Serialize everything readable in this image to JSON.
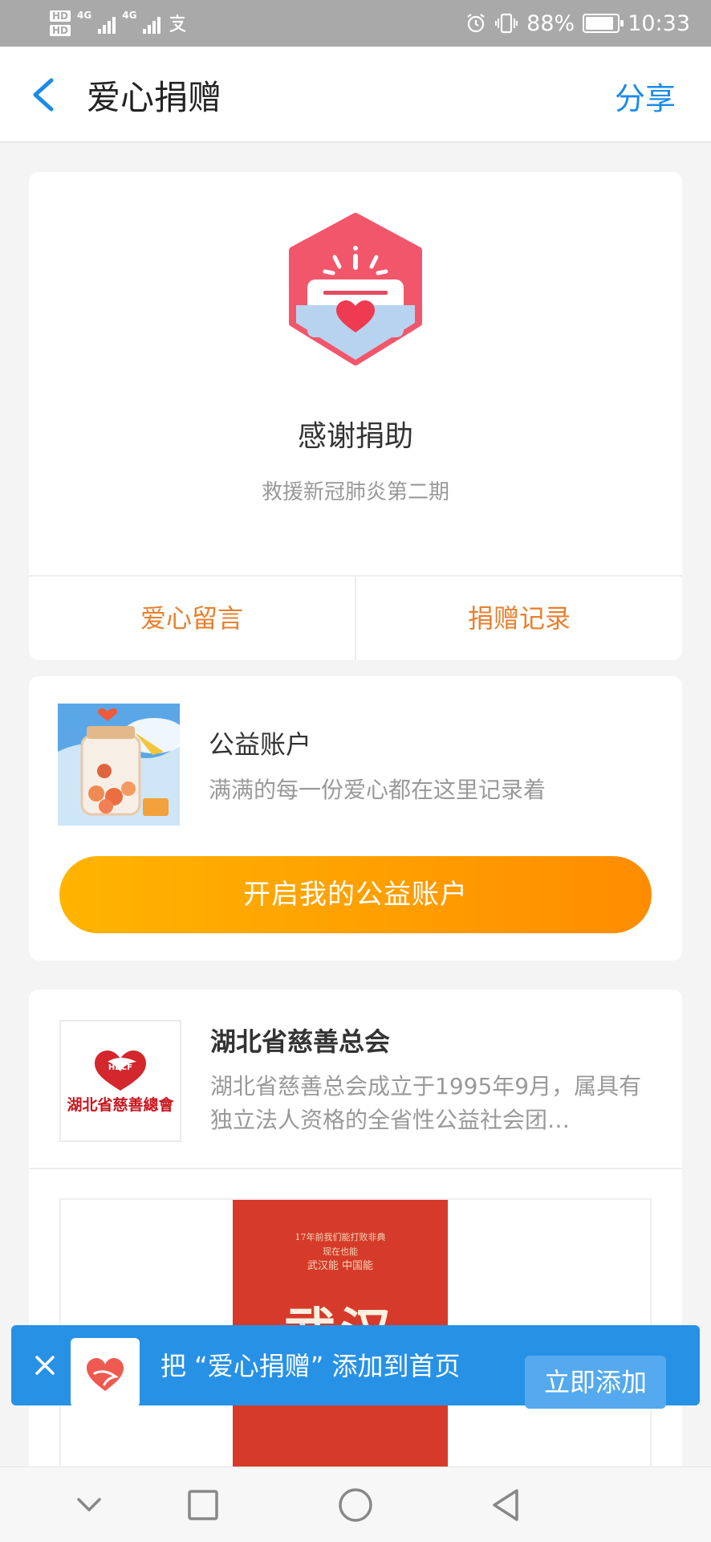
{
  "status_bar": {
    "hd1": "HD",
    "hd2": "HD",
    "net1": "4G",
    "net2": "4G",
    "battery_pct": "88%",
    "battery_level": 0.88,
    "time": "10:33"
  },
  "header": {
    "title": "爱心捐赠",
    "share_label": "分享"
  },
  "donation_card": {
    "thanks_text": "感谢捐助",
    "project_name": "救援新冠肺炎第二期",
    "actions": [
      "爱心留言",
      "捐赠记录"
    ]
  },
  "account_card": {
    "title": "公益账户",
    "description": "满满的每一份爱心都在这里记录着",
    "button_label": "开启我的公益账户"
  },
  "org_card": {
    "logo_text": "湖北省慈善總會",
    "logo_badge": "HBCF",
    "name": "湖北省慈善总会",
    "description": "湖北省慈善总会成立于1995年9月，属具有独立法人资格的全省性公益社会团…",
    "poster_lines": [
      "17年前我们能打败非典",
      "现在也能",
      "武汉能 中国能"
    ],
    "poster_title": "武汉"
  },
  "banner": {
    "text": "把 “爱心捐赠” 添加到首页",
    "button_label": "立即添加"
  },
  "colors": {
    "accent_blue": "#1c8be8",
    "orange_text": "#e8802f",
    "button_orange": "#ffa000",
    "logo_pink": "#f2566b",
    "banner_blue": "#2791e6"
  }
}
